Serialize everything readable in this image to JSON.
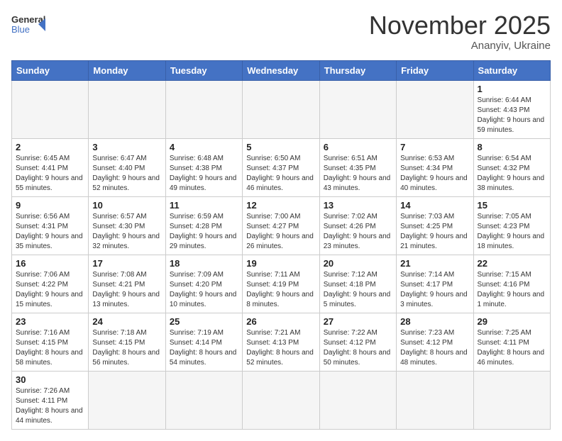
{
  "header": {
    "logo_general": "General",
    "logo_blue": "Blue",
    "month_title": "November 2025",
    "location": "Ananyiv, Ukraine"
  },
  "weekdays": [
    "Sunday",
    "Monday",
    "Tuesday",
    "Wednesday",
    "Thursday",
    "Friday",
    "Saturday"
  ],
  "days": [
    {
      "date": null,
      "info": null
    },
    {
      "date": null,
      "info": null
    },
    {
      "date": null,
      "info": null
    },
    {
      "date": null,
      "info": null
    },
    {
      "date": null,
      "info": null
    },
    {
      "date": null,
      "info": null
    },
    {
      "date": "1",
      "info": "Sunrise: 6:44 AM\nSunset: 4:43 PM\nDaylight: 9 hours and 59 minutes."
    },
    {
      "date": "2",
      "info": "Sunrise: 6:45 AM\nSunset: 4:41 PM\nDaylight: 9 hours and 55 minutes."
    },
    {
      "date": "3",
      "info": "Sunrise: 6:47 AM\nSunset: 4:40 PM\nDaylight: 9 hours and 52 minutes."
    },
    {
      "date": "4",
      "info": "Sunrise: 6:48 AM\nSunset: 4:38 PM\nDaylight: 9 hours and 49 minutes."
    },
    {
      "date": "5",
      "info": "Sunrise: 6:50 AM\nSunset: 4:37 PM\nDaylight: 9 hours and 46 minutes."
    },
    {
      "date": "6",
      "info": "Sunrise: 6:51 AM\nSunset: 4:35 PM\nDaylight: 9 hours and 43 minutes."
    },
    {
      "date": "7",
      "info": "Sunrise: 6:53 AM\nSunset: 4:34 PM\nDaylight: 9 hours and 40 minutes."
    },
    {
      "date": "8",
      "info": "Sunrise: 6:54 AM\nSunset: 4:32 PM\nDaylight: 9 hours and 38 minutes."
    },
    {
      "date": "9",
      "info": "Sunrise: 6:56 AM\nSunset: 4:31 PM\nDaylight: 9 hours and 35 minutes."
    },
    {
      "date": "10",
      "info": "Sunrise: 6:57 AM\nSunset: 4:30 PM\nDaylight: 9 hours and 32 minutes."
    },
    {
      "date": "11",
      "info": "Sunrise: 6:59 AM\nSunset: 4:28 PM\nDaylight: 9 hours and 29 minutes."
    },
    {
      "date": "12",
      "info": "Sunrise: 7:00 AM\nSunset: 4:27 PM\nDaylight: 9 hours and 26 minutes."
    },
    {
      "date": "13",
      "info": "Sunrise: 7:02 AM\nSunset: 4:26 PM\nDaylight: 9 hours and 23 minutes."
    },
    {
      "date": "14",
      "info": "Sunrise: 7:03 AM\nSunset: 4:25 PM\nDaylight: 9 hours and 21 minutes."
    },
    {
      "date": "15",
      "info": "Sunrise: 7:05 AM\nSunset: 4:23 PM\nDaylight: 9 hours and 18 minutes."
    },
    {
      "date": "16",
      "info": "Sunrise: 7:06 AM\nSunset: 4:22 PM\nDaylight: 9 hours and 15 minutes."
    },
    {
      "date": "17",
      "info": "Sunrise: 7:08 AM\nSunset: 4:21 PM\nDaylight: 9 hours and 13 minutes."
    },
    {
      "date": "18",
      "info": "Sunrise: 7:09 AM\nSunset: 4:20 PM\nDaylight: 9 hours and 10 minutes."
    },
    {
      "date": "19",
      "info": "Sunrise: 7:11 AM\nSunset: 4:19 PM\nDaylight: 9 hours and 8 minutes."
    },
    {
      "date": "20",
      "info": "Sunrise: 7:12 AM\nSunset: 4:18 PM\nDaylight: 9 hours and 5 minutes."
    },
    {
      "date": "21",
      "info": "Sunrise: 7:14 AM\nSunset: 4:17 PM\nDaylight: 9 hours and 3 minutes."
    },
    {
      "date": "22",
      "info": "Sunrise: 7:15 AM\nSunset: 4:16 PM\nDaylight: 9 hours and 1 minute."
    },
    {
      "date": "23",
      "info": "Sunrise: 7:16 AM\nSunset: 4:15 PM\nDaylight: 8 hours and 58 minutes."
    },
    {
      "date": "24",
      "info": "Sunrise: 7:18 AM\nSunset: 4:15 PM\nDaylight: 8 hours and 56 minutes."
    },
    {
      "date": "25",
      "info": "Sunrise: 7:19 AM\nSunset: 4:14 PM\nDaylight: 8 hours and 54 minutes."
    },
    {
      "date": "26",
      "info": "Sunrise: 7:21 AM\nSunset: 4:13 PM\nDaylight: 8 hours and 52 minutes."
    },
    {
      "date": "27",
      "info": "Sunrise: 7:22 AM\nSunset: 4:12 PM\nDaylight: 8 hours and 50 minutes."
    },
    {
      "date": "28",
      "info": "Sunrise: 7:23 AM\nSunset: 4:12 PM\nDaylight: 8 hours and 48 minutes."
    },
    {
      "date": "29",
      "info": "Sunrise: 7:25 AM\nSunset: 4:11 PM\nDaylight: 8 hours and 46 minutes."
    },
    {
      "date": "30",
      "info": "Sunrise: 7:26 AM\nSunset: 4:11 PM\nDaylight: 8 hours and 44 minutes."
    },
    {
      "date": null,
      "info": null
    },
    {
      "date": null,
      "info": null
    },
    {
      "date": null,
      "info": null
    },
    {
      "date": null,
      "info": null
    },
    {
      "date": null,
      "info": null
    },
    {
      "date": null,
      "info": null
    }
  ]
}
